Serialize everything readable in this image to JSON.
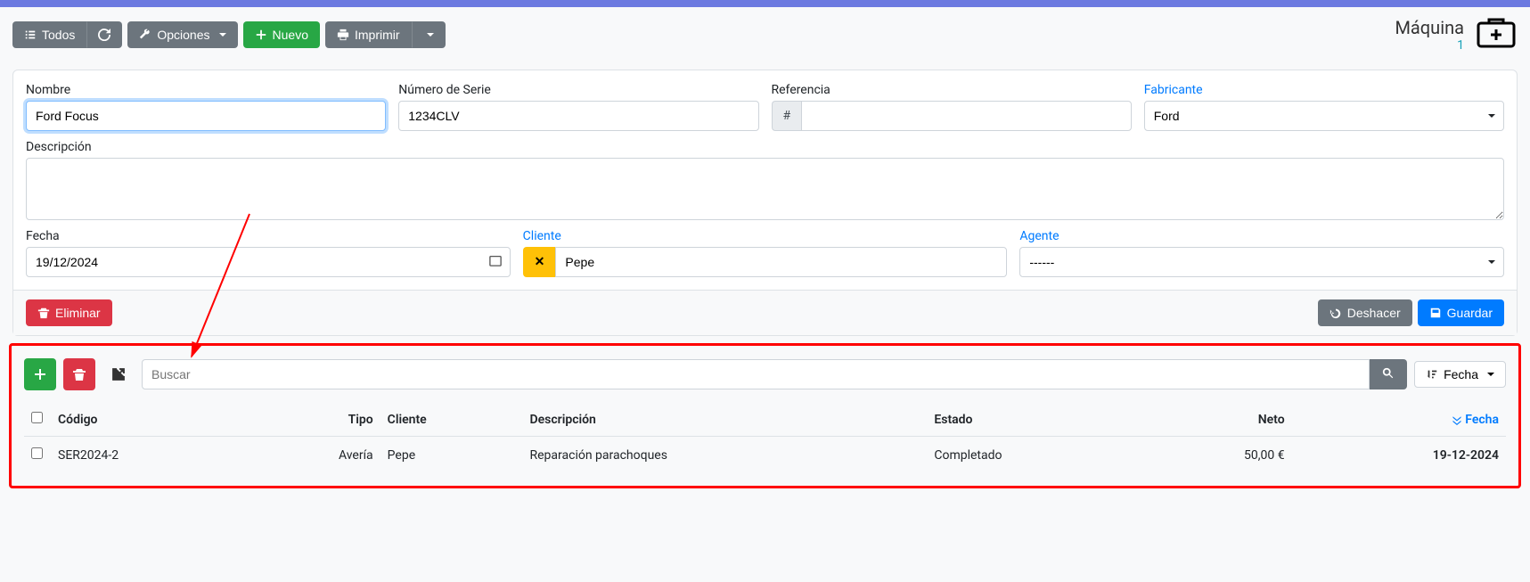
{
  "page": {
    "title": "Máquina",
    "id": "1"
  },
  "toolbar": {
    "todos": "Todos",
    "opciones": "Opciones",
    "nuevo": "Nuevo",
    "imprimir": "Imprimir"
  },
  "form": {
    "nombre": {
      "label": "Nombre",
      "value": "Ford Focus"
    },
    "serie": {
      "label": "Número de Serie",
      "value": "1234CLV"
    },
    "referencia": {
      "label": "Referencia",
      "value": ""
    },
    "fabricante": {
      "label": "Fabricante",
      "value": "Ford"
    },
    "descripcion": {
      "label": "Descripción",
      "value": ""
    },
    "fecha": {
      "label": "Fecha",
      "value": "19/12/2024"
    },
    "cliente": {
      "label": "Cliente",
      "value": "Pepe"
    },
    "agente": {
      "label": "Agente",
      "value": "------"
    }
  },
  "actions": {
    "eliminar": "Eliminar",
    "deshacer": "Deshacer",
    "guardar": "Guardar"
  },
  "list": {
    "search_placeholder": "Buscar",
    "sort_label": "Fecha",
    "columns": {
      "codigo": "Código",
      "tipo": "Tipo",
      "cliente": "Cliente",
      "descripcion": "Descripción",
      "estado": "Estado",
      "neto": "Neto",
      "fecha": "Fecha"
    },
    "rows": [
      {
        "codigo": "SER2024-2",
        "tipo": "Avería",
        "cliente": "Pepe",
        "descripcion": "Reparación parachoques",
        "estado": "Completado",
        "neto": "50,00 €",
        "fecha": "19-12-2024"
      }
    ]
  }
}
